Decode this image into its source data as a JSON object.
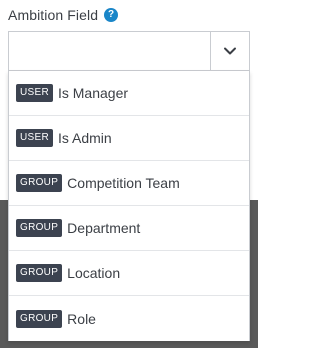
{
  "field": {
    "label": "Ambition Field",
    "help_icon": "question-mark-icon",
    "help_glyph": "?",
    "selected_value": "",
    "toggle_icon": "chevron-down-icon"
  },
  "colors": {
    "badge_bg": "#3c4350",
    "help_icon_bg": "#1a86c8"
  },
  "options": [
    {
      "badge": "USER",
      "label": "Is Manager"
    },
    {
      "badge": "USER",
      "label": "Is Admin"
    },
    {
      "badge": "GROUP",
      "label": "Competition Team"
    },
    {
      "badge": "GROUP",
      "label": "Department"
    },
    {
      "badge": "GROUP",
      "label": "Location"
    },
    {
      "badge": "GROUP",
      "label": "Role"
    }
  ]
}
